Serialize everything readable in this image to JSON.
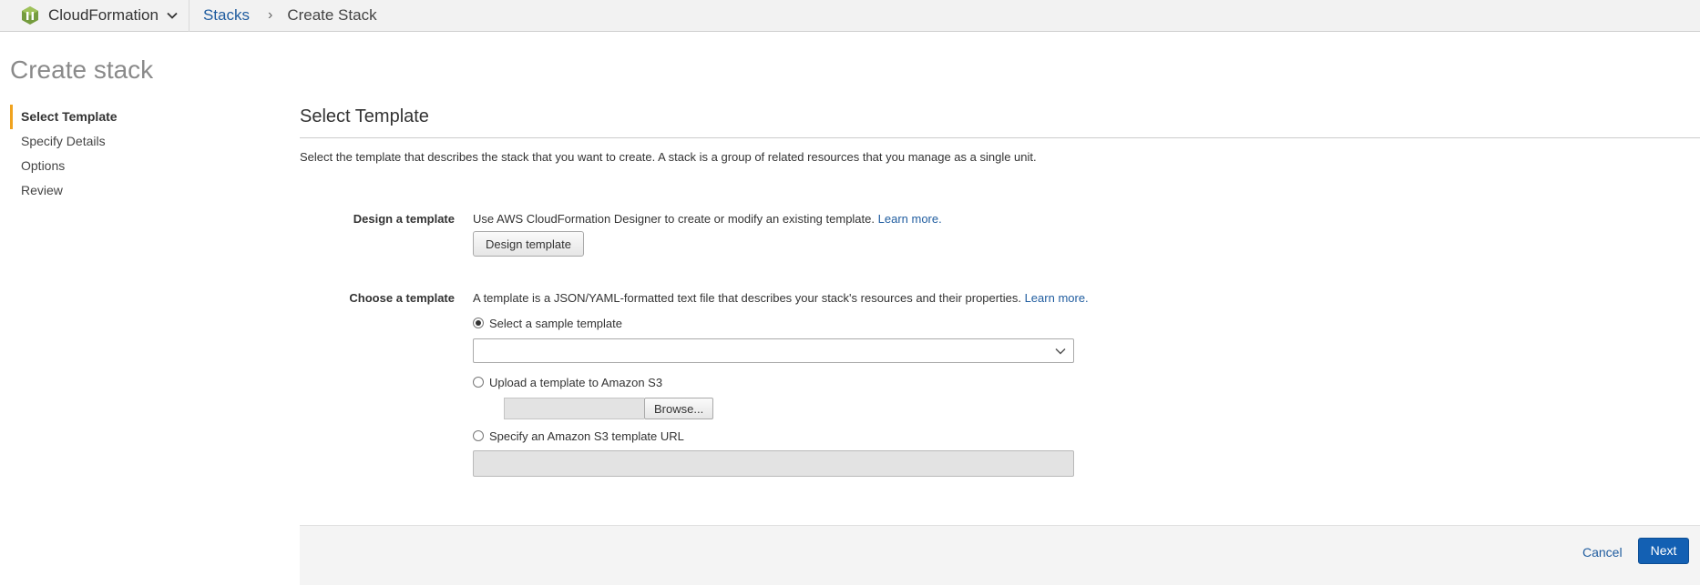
{
  "topbar": {
    "service_name": "CloudFormation",
    "breadcrumb_link": "Stacks",
    "breadcrumb_separator": "›",
    "breadcrumb_current": "Create Stack"
  },
  "page": {
    "title": "Create stack"
  },
  "steps": [
    {
      "label": "Select Template",
      "active": true
    },
    {
      "label": "Specify Details",
      "active": false
    },
    {
      "label": "Options",
      "active": false
    },
    {
      "label": "Review",
      "active": false
    }
  ],
  "section": {
    "title": "Select Template",
    "intro": "Select the template that describes the stack that you want to create. A stack is a group of related resources that you manage as a single unit."
  },
  "design": {
    "label": "Design a template",
    "description": "Use AWS CloudFormation Designer to create or modify an existing template.",
    "learn_more": "Learn more.",
    "button": "Design template"
  },
  "choose": {
    "label": "Choose a template",
    "description": "A template is a JSON/YAML-formatted text file that describes your stack's resources and their properties.",
    "learn_more": "Learn more.",
    "options": {
      "sample": {
        "label": "Select a sample template",
        "selected": true,
        "select_value": ""
      },
      "upload": {
        "label": "Upload a template to Amazon S3",
        "selected": false,
        "file_name": "",
        "browse": "Browse..."
      },
      "url": {
        "label": "Specify an Amazon S3 template URL",
        "selected": false,
        "value": ""
      }
    }
  },
  "footer": {
    "cancel": "Cancel",
    "next": "Next"
  },
  "colors": {
    "link": "#1f5c9f",
    "active_step_marker": "#f0a31f",
    "primary_button": "#1360b3",
    "title_gray": "#8a8a8a"
  },
  "icons": {
    "service_logo": "cloudformation-logo-icon",
    "service_menu": "chevron-down-icon",
    "select_caret": "chevron-down-icon"
  }
}
